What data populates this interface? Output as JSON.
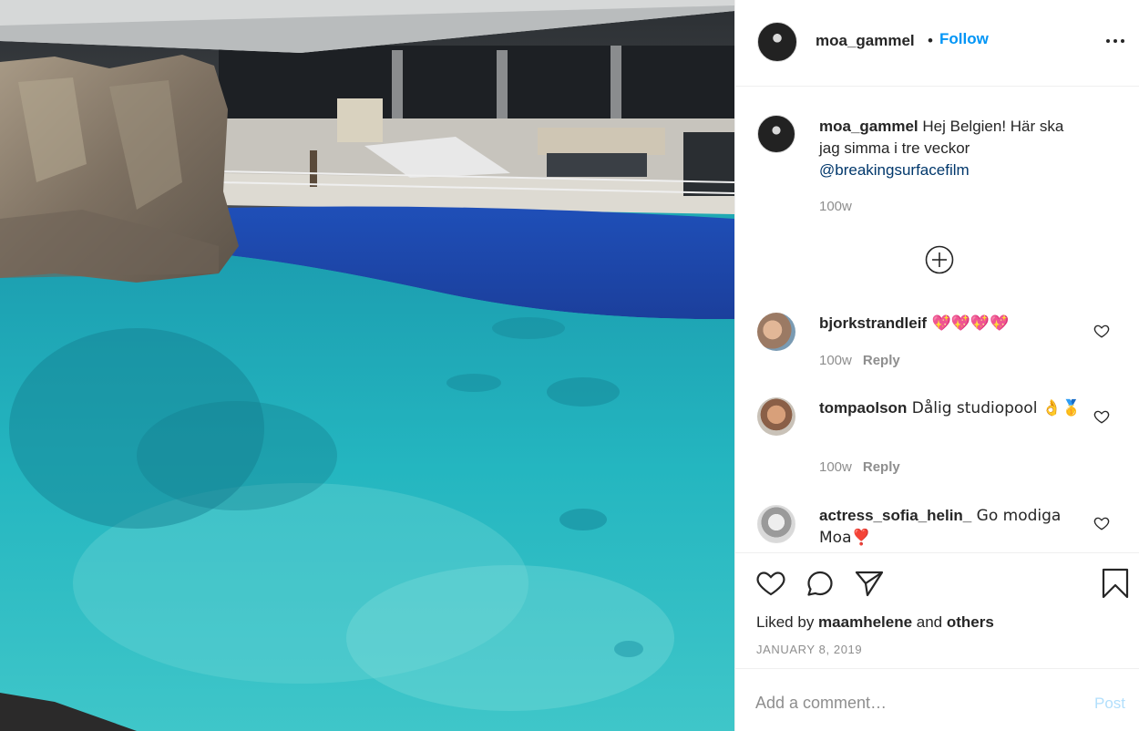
{
  "post": {
    "owner_username": "moa_gammel",
    "separator": "•",
    "follow_label": "Follow",
    "more_label": "More options"
  },
  "caption": {
    "username": "moa_gammel",
    "text": " Hej Belgien! Här ska jag simma i tre veckor ",
    "mention": "@breakingsurfacefilm",
    "age": "100w"
  },
  "comments": [
    {
      "username": "bjorkstrandleif",
      "text": " 💖💖💖💖",
      "age": "100w",
      "reply_label": "Reply"
    },
    {
      "username": "tompaolson",
      "text": " Dålig studiopool 👌🥇",
      "age": "100w",
      "reply_label": "Reply"
    },
    {
      "username": "actress_sofia_helin_",
      "text": " Go modiga Moa❣️",
      "age": "",
      "reply_label": ""
    }
  ],
  "actions": {
    "liked_prefix": "Liked by ",
    "liked_user": "maamhelene",
    "liked_and": " and ",
    "liked_others": "others",
    "date": "JANUARY 8, 2019"
  },
  "add_comment": {
    "placeholder": "Add a comment…",
    "post_label": "Post"
  },
  "colors": {
    "accent": "#0095f6",
    "link": "#00376b",
    "post_disabled": "#b2dffc",
    "muted": "#8e8e8e"
  },
  "icons": {
    "like": "heart-icon",
    "comment": "comment-bubble-icon",
    "share": "paper-plane-icon",
    "save": "bookmark-icon",
    "load_more": "plus-circle-icon",
    "more": "ellipsis-icon"
  }
}
